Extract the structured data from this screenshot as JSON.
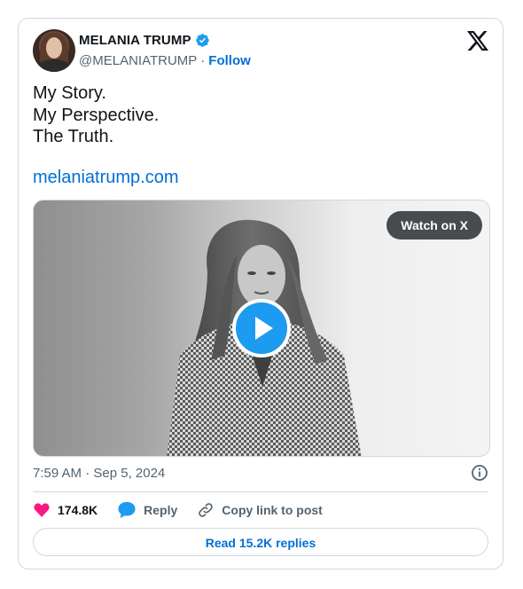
{
  "tweet": {
    "author": {
      "name": "MELANIA TRUMP",
      "handle": "@MELANIATRUMP",
      "separator": "·",
      "follow_label": "Follow"
    },
    "text_lines": [
      "My Story.",
      "My Perspective.",
      "The Truth."
    ],
    "link_text": "melaniatrump.com",
    "media": {
      "watch_label": "Watch on X"
    },
    "timestamp": "7:59 AM · Sep 5, 2024",
    "actions": {
      "like_count": "174.8K",
      "reply_label": "Reply",
      "copy_label": "Copy link to post"
    },
    "replies_button_label": "Read 15.2K replies"
  },
  "icons": {
    "brand": "x-logo-icon",
    "verified": "verified-badge-icon",
    "play": "play-icon",
    "info": "info-icon",
    "like": "heart-icon",
    "reply": "speech-bubble-icon",
    "copy": "link-icon"
  },
  "colors": {
    "accent": "#006fd6",
    "verified": "#1d9bf0",
    "like": "#f91880",
    "secondary_text": "#536471",
    "border": "#cfd9de"
  }
}
